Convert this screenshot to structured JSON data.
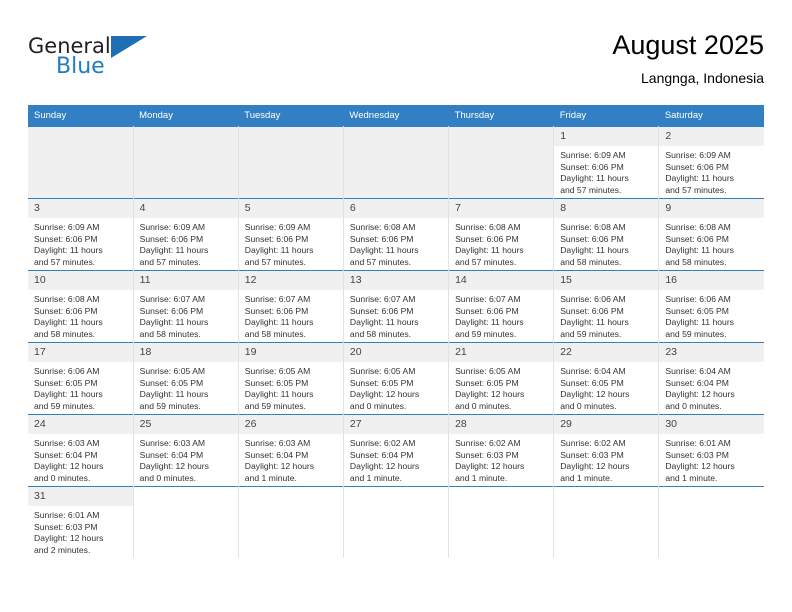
{
  "brand": {
    "name_part1": "General",
    "name_part2": "Blue",
    "accent_color": "#1f7dc4",
    "header_color": "#3280c3"
  },
  "header": {
    "title": "August 2025",
    "subtitle": "Langnga, Indonesia"
  },
  "weekday_headers": [
    "Sunday",
    "Monday",
    "Tuesday",
    "Wednesday",
    "Thursday",
    "Friday",
    "Saturday"
  ],
  "weeks": [
    [
      {
        "empty": true
      },
      {
        "empty": true
      },
      {
        "empty": true
      },
      {
        "empty": true
      },
      {
        "empty": true
      },
      {
        "day": "1",
        "sunrise": "Sunrise: 6:09 AM",
        "sunset": "Sunset: 6:06 PM",
        "daylight1": "Daylight: 11 hours",
        "daylight2": "and 57 minutes."
      },
      {
        "day": "2",
        "sunrise": "Sunrise: 6:09 AM",
        "sunset": "Sunset: 6:06 PM",
        "daylight1": "Daylight: 11 hours",
        "daylight2": "and 57 minutes."
      }
    ],
    [
      {
        "day": "3",
        "sunrise": "Sunrise: 6:09 AM",
        "sunset": "Sunset: 6:06 PM",
        "daylight1": "Daylight: 11 hours",
        "daylight2": "and 57 minutes."
      },
      {
        "day": "4",
        "sunrise": "Sunrise: 6:09 AM",
        "sunset": "Sunset: 6:06 PM",
        "daylight1": "Daylight: 11 hours",
        "daylight2": "and 57 minutes."
      },
      {
        "day": "5",
        "sunrise": "Sunrise: 6:09 AM",
        "sunset": "Sunset: 6:06 PM",
        "daylight1": "Daylight: 11 hours",
        "daylight2": "and 57 minutes."
      },
      {
        "day": "6",
        "sunrise": "Sunrise: 6:08 AM",
        "sunset": "Sunset: 6:06 PM",
        "daylight1": "Daylight: 11 hours",
        "daylight2": "and 57 minutes."
      },
      {
        "day": "7",
        "sunrise": "Sunrise: 6:08 AM",
        "sunset": "Sunset: 6:06 PM",
        "daylight1": "Daylight: 11 hours",
        "daylight2": "and 57 minutes."
      },
      {
        "day": "8",
        "sunrise": "Sunrise: 6:08 AM",
        "sunset": "Sunset: 6:06 PM",
        "daylight1": "Daylight: 11 hours",
        "daylight2": "and 58 minutes."
      },
      {
        "day": "9",
        "sunrise": "Sunrise: 6:08 AM",
        "sunset": "Sunset: 6:06 PM",
        "daylight1": "Daylight: 11 hours",
        "daylight2": "and 58 minutes."
      }
    ],
    [
      {
        "day": "10",
        "sunrise": "Sunrise: 6:08 AM",
        "sunset": "Sunset: 6:06 PM",
        "daylight1": "Daylight: 11 hours",
        "daylight2": "and 58 minutes."
      },
      {
        "day": "11",
        "sunrise": "Sunrise: 6:07 AM",
        "sunset": "Sunset: 6:06 PM",
        "daylight1": "Daylight: 11 hours",
        "daylight2": "and 58 minutes."
      },
      {
        "day": "12",
        "sunrise": "Sunrise: 6:07 AM",
        "sunset": "Sunset: 6:06 PM",
        "daylight1": "Daylight: 11 hours",
        "daylight2": "and 58 minutes."
      },
      {
        "day": "13",
        "sunrise": "Sunrise: 6:07 AM",
        "sunset": "Sunset: 6:06 PM",
        "daylight1": "Daylight: 11 hours",
        "daylight2": "and 58 minutes."
      },
      {
        "day": "14",
        "sunrise": "Sunrise: 6:07 AM",
        "sunset": "Sunset: 6:06 PM",
        "daylight1": "Daylight: 11 hours",
        "daylight2": "and 59 minutes."
      },
      {
        "day": "15",
        "sunrise": "Sunrise: 6:06 AM",
        "sunset": "Sunset: 6:06 PM",
        "daylight1": "Daylight: 11 hours",
        "daylight2": "and 59 minutes."
      },
      {
        "day": "16",
        "sunrise": "Sunrise: 6:06 AM",
        "sunset": "Sunset: 6:05 PM",
        "daylight1": "Daylight: 11 hours",
        "daylight2": "and 59 minutes."
      }
    ],
    [
      {
        "day": "17",
        "sunrise": "Sunrise: 6:06 AM",
        "sunset": "Sunset: 6:05 PM",
        "daylight1": "Daylight: 11 hours",
        "daylight2": "and 59 minutes."
      },
      {
        "day": "18",
        "sunrise": "Sunrise: 6:05 AM",
        "sunset": "Sunset: 6:05 PM",
        "daylight1": "Daylight: 11 hours",
        "daylight2": "and 59 minutes."
      },
      {
        "day": "19",
        "sunrise": "Sunrise: 6:05 AM",
        "sunset": "Sunset: 6:05 PM",
        "daylight1": "Daylight: 11 hours",
        "daylight2": "and 59 minutes."
      },
      {
        "day": "20",
        "sunrise": "Sunrise: 6:05 AM",
        "sunset": "Sunset: 6:05 PM",
        "daylight1": "Daylight: 12 hours",
        "daylight2": "and 0 minutes."
      },
      {
        "day": "21",
        "sunrise": "Sunrise: 6:05 AM",
        "sunset": "Sunset: 6:05 PM",
        "daylight1": "Daylight: 12 hours",
        "daylight2": "and 0 minutes."
      },
      {
        "day": "22",
        "sunrise": "Sunrise: 6:04 AM",
        "sunset": "Sunset: 6:05 PM",
        "daylight1": "Daylight: 12 hours",
        "daylight2": "and 0 minutes."
      },
      {
        "day": "23",
        "sunrise": "Sunrise: 6:04 AM",
        "sunset": "Sunset: 6:04 PM",
        "daylight1": "Daylight: 12 hours",
        "daylight2": "and 0 minutes."
      }
    ],
    [
      {
        "day": "24",
        "sunrise": "Sunrise: 6:03 AM",
        "sunset": "Sunset: 6:04 PM",
        "daylight1": "Daylight: 12 hours",
        "daylight2": "and 0 minutes."
      },
      {
        "day": "25",
        "sunrise": "Sunrise: 6:03 AM",
        "sunset": "Sunset: 6:04 PM",
        "daylight1": "Daylight: 12 hours",
        "daylight2": "and 0 minutes."
      },
      {
        "day": "26",
        "sunrise": "Sunrise: 6:03 AM",
        "sunset": "Sunset: 6:04 PM",
        "daylight1": "Daylight: 12 hours",
        "daylight2": "and 1 minute."
      },
      {
        "day": "27",
        "sunrise": "Sunrise: 6:02 AM",
        "sunset": "Sunset: 6:04 PM",
        "daylight1": "Daylight: 12 hours",
        "daylight2": "and 1 minute."
      },
      {
        "day": "28",
        "sunrise": "Sunrise: 6:02 AM",
        "sunset": "Sunset: 6:03 PM",
        "daylight1": "Daylight: 12 hours",
        "daylight2": "and 1 minute."
      },
      {
        "day": "29",
        "sunrise": "Sunrise: 6:02 AM",
        "sunset": "Sunset: 6:03 PM",
        "daylight1": "Daylight: 12 hours",
        "daylight2": "and 1 minute."
      },
      {
        "day": "30",
        "sunrise": "Sunrise: 6:01 AM",
        "sunset": "Sunset: 6:03 PM",
        "daylight1": "Daylight: 12 hours",
        "daylight2": "and 1 minute."
      }
    ],
    [
      {
        "day": "31",
        "sunrise": "Sunrise: 6:01 AM",
        "sunset": "Sunset: 6:03 PM",
        "daylight1": "Daylight: 12 hours",
        "daylight2": "and 2 minutes."
      },
      {
        "blank": true
      },
      {
        "blank": true
      },
      {
        "blank": true
      },
      {
        "blank": true
      },
      {
        "blank": true
      },
      {
        "blank": true
      }
    ]
  ]
}
